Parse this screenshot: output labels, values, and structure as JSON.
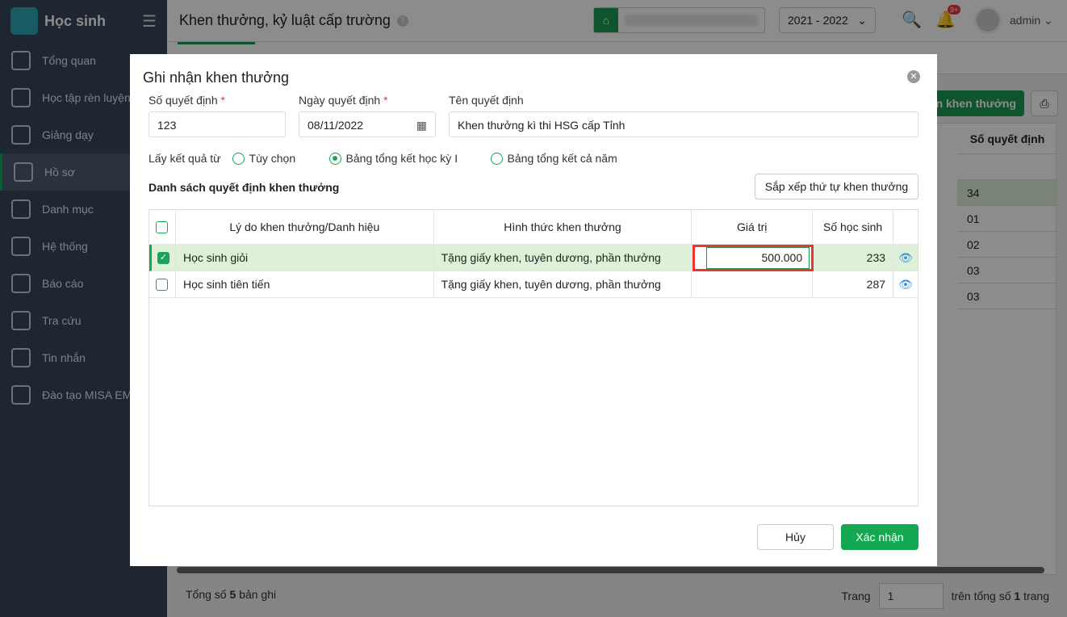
{
  "app": {
    "name": "Học sinh"
  },
  "sidebar": {
    "items": [
      {
        "label": "Tổng quan"
      },
      {
        "label": "Học tập rèn luyện"
      },
      {
        "label": "Giảng dạy"
      },
      {
        "label": "Hồ sơ"
      },
      {
        "label": "Danh mục"
      },
      {
        "label": "Hệ thống"
      },
      {
        "label": "Báo cáo"
      },
      {
        "label": "Tra cứu"
      },
      {
        "label": "Tin nhắn"
      },
      {
        "label": "Đào tạo MISA EMIS"
      }
    ]
  },
  "header": {
    "title": "Khen thưởng, kỷ luật cấp trường",
    "help": "?",
    "year": "2021 - 2022",
    "notif_badge": "9+",
    "user": "admin"
  },
  "background": {
    "add_button": "n khen thưởng",
    "column_header": "Số quyết định",
    "column_values": [
      "34",
      "01",
      "02",
      "03",
      "03"
    ],
    "total_prefix": "Tổng số ",
    "total_count": "5",
    "total_suffix": " bản ghi",
    "page_label": "Trang",
    "page_value": "1",
    "page_suffix_prefix": "trên tổng số ",
    "page_total": "1",
    "page_suffix": " trang"
  },
  "modal": {
    "title": "Ghi nhận khen thưởng",
    "fields": {
      "number_label": "Số quyết định",
      "number_value": "123",
      "date_label": "Ngày quyết định",
      "date_value": "08/11/2022",
      "name_label": "Tên quyết định",
      "name_value": "Khen thưởng kì thi HSG cấp Tỉnh"
    },
    "source_label": "Lấy kết quả từ",
    "sources": [
      {
        "label": "Tùy chọn",
        "selected": false
      },
      {
        "label": "Bảng tổng kết học kỳ I",
        "selected": true
      },
      {
        "label": "Bảng tổng kết cả năm",
        "selected": false
      }
    ],
    "section_title": "Danh sách quyết định khen thưởng",
    "sort_button": "Sắp xếp thứ tự khen thưởng",
    "table": {
      "headers": [
        "Lý do khen thưởng/Danh hiệu",
        "Hình thức khen thưởng",
        "Giá trị",
        "Số học sinh"
      ],
      "rows": [
        {
          "reason": "Học sinh giỏi",
          "form": "Tặng giấy khen, tuyên dương, phần thưởng",
          "value": "500.000",
          "count": "233",
          "checked": true
        },
        {
          "reason": "Học sinh tiên tiến",
          "form": "Tặng giấy khen, tuyên dương, phần thưởng",
          "value": "",
          "count": "287",
          "checked": false
        }
      ]
    },
    "cancel": "Hủy",
    "confirm": "Xác nhận"
  },
  "colors": {
    "accent": "#14a853",
    "highlight": "#e33333"
  }
}
